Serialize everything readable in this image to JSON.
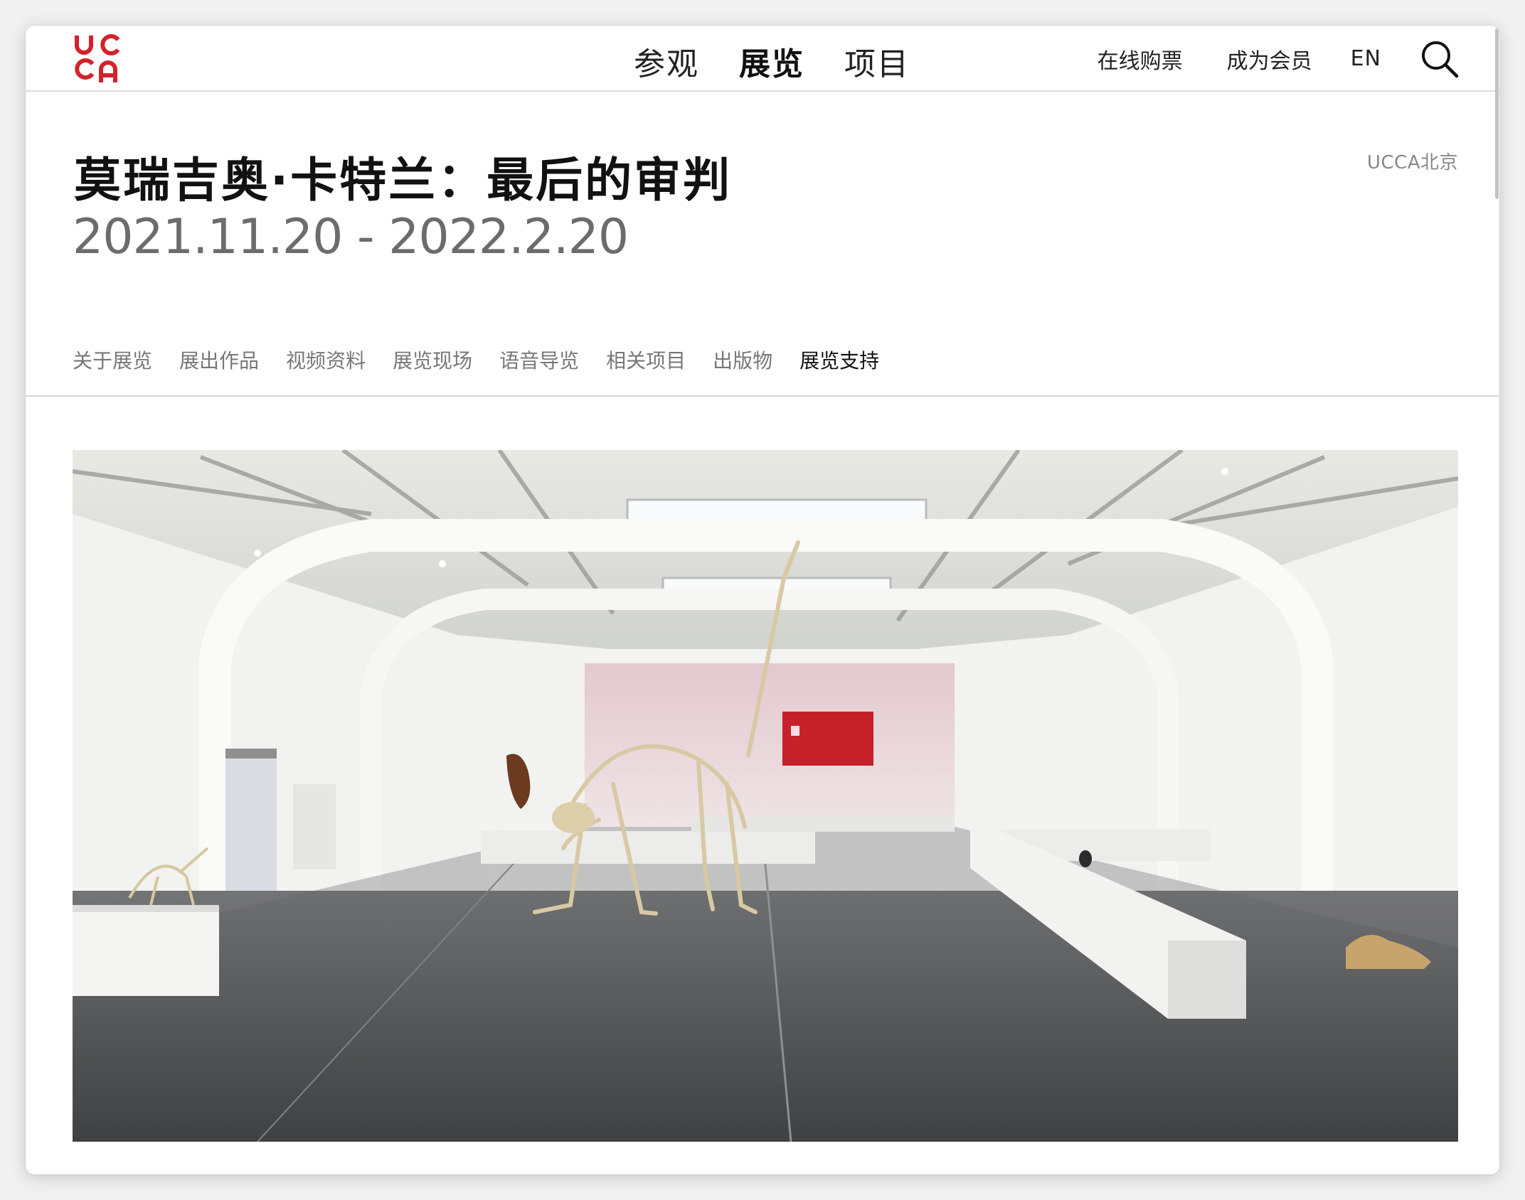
{
  "brand": {
    "logo_letters": "UCCA",
    "logo_color": "#d2232a"
  },
  "main_nav": {
    "items": [
      {
        "label": "参观",
        "active": false
      },
      {
        "label": "展览",
        "active": true
      },
      {
        "label": "项目",
        "active": false
      }
    ]
  },
  "util_nav": {
    "ticket": "在线购票",
    "member": "成为会员",
    "lang": "EN",
    "search_icon": "search-icon"
  },
  "exhibition": {
    "venue": "UCCA北京",
    "title": "莫瑞吉奥·卡特兰：最后的审判",
    "dates": "2021.11.20 - 2022.2.20"
  },
  "sub_nav": {
    "items": [
      {
        "label": "关于展览",
        "active": false
      },
      {
        "label": "展出作品",
        "active": false
      },
      {
        "label": "视频资料",
        "active": false
      },
      {
        "label": "展览现场",
        "active": false
      },
      {
        "label": "语音导览",
        "active": false
      },
      {
        "label": "相关项目",
        "active": false
      },
      {
        "label": "出版物",
        "active": false
      },
      {
        "label": "展览支持",
        "active": true
      }
    ]
  },
  "hero_image": {
    "subject": "exhibition-hall-installation-view"
  }
}
